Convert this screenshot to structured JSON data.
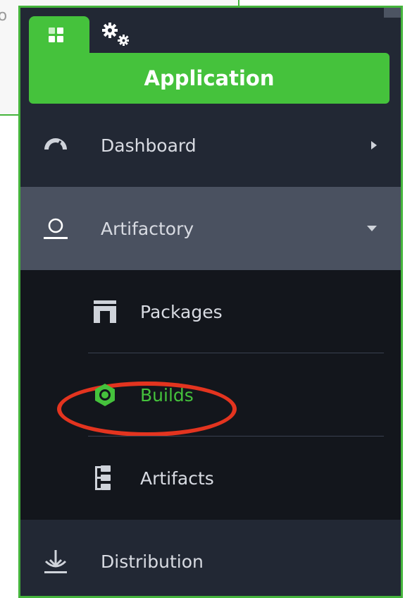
{
  "background": {
    "partial_text": "tio"
  },
  "tabs": {
    "application_tab": "application",
    "admin_tab": "admin"
  },
  "header": {
    "title": "Application"
  },
  "nav": {
    "dashboard": "Dashboard",
    "artifactory": "Artifactory",
    "packages": "Packages",
    "builds": "Builds",
    "artifacts": "Artifacts",
    "distribution": "Distribution"
  },
  "colors": {
    "accent_green": "#45c23c",
    "panel_bg": "#222834",
    "active_bg": "#4a5160",
    "submenu_bg": "#13161c",
    "highlight_red": "#e3341f"
  },
  "icons": {
    "dashboard": "speedometer-icon",
    "artifactory": "artifactory-icon",
    "packages": "packages-icon",
    "builds": "builds-hexagon-icon",
    "artifacts": "artifacts-tree-icon",
    "distribution": "distribution-anchor-icon"
  }
}
